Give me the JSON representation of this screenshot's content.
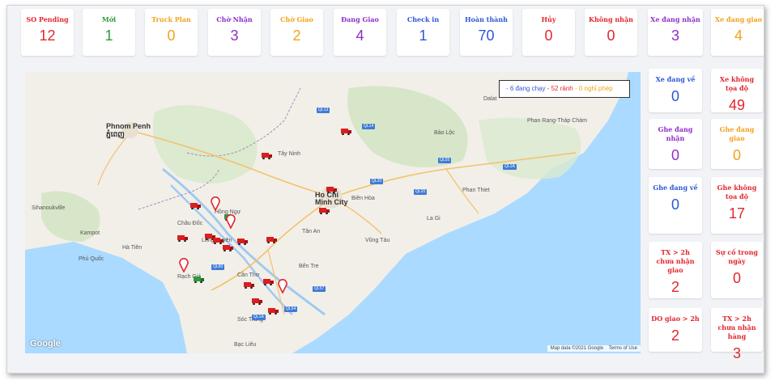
{
  "top_stats": [
    {
      "label": "SO Pending",
      "value": "12",
      "label_color": "#e3262d",
      "value_color": "#e3262d"
    },
    {
      "label": "Mới",
      "value": "1",
      "label_color": "#2c9a3a",
      "value_color": "#2c9a3a"
    },
    {
      "label": "Truck Plan",
      "value": "0",
      "label_color": "#f2a31a",
      "value_color": "#f2a31a"
    },
    {
      "label": "Chờ Nhận",
      "value": "3",
      "label_color": "#8e2fc9",
      "value_color": "#8e2fc9"
    },
    {
      "label": "Chờ Giao",
      "value": "2",
      "label_color": "#f2a31a",
      "value_color": "#f2a31a"
    },
    {
      "label": "Đang Giao",
      "value": "4",
      "label_color": "#8e2fc9",
      "value_color": "#8e2fc9"
    },
    {
      "label": "Check in",
      "value": "1",
      "label_color": "#2f56d6",
      "value_color": "#2f56d6"
    },
    {
      "label": "Hoàn thành",
      "value": "70",
      "label_color": "#2f56d6",
      "value_color": "#2f56d6"
    },
    {
      "label": "Hủy",
      "value": "0",
      "label_color": "#e3262d",
      "value_color": "#e3262d"
    },
    {
      "label": "Không nhận",
      "value": "0",
      "label_color": "#e3262d",
      "value_color": "#e3262d"
    },
    {
      "label": "Xe đang nhận",
      "value": "3",
      "label_color": "#8e2fc9",
      "value_color": "#8e2fc9"
    },
    {
      "label": "Xe đang giao",
      "value": "4",
      "label_color": "#f2a31a",
      "value_color": "#f2a31a"
    }
  ],
  "side_stats": [
    {
      "label": "Xe đang về",
      "value": "0",
      "label_color": "#2f56d6",
      "value_color": "#2f56d6"
    },
    {
      "label": "Xe không tọa độ",
      "value": "49",
      "label_color": "#e3262d",
      "value_color": "#e3262d"
    },
    {
      "label": "Ghe đang nhận",
      "value": "0",
      "label_color": "#8e2fc9",
      "value_color": "#8e2fc9"
    },
    {
      "label": "Ghe đang giao",
      "value": "0",
      "label_color": "#f2a31a",
      "value_color": "#f2a31a"
    },
    {
      "label": "Ghe đang về",
      "value": "0",
      "label_color": "#2f56d6",
      "value_color": "#2f56d6"
    },
    {
      "label": "Ghe không tọa độ",
      "value": "17",
      "label_color": "#e3262d",
      "value_color": "#e3262d"
    },
    {
      "label": "TX > 2h chưa nhận giao",
      "value": "2",
      "label_color": "#e3262d",
      "value_color": "#e3262d"
    },
    {
      "label": "Sự cố trong ngày",
      "value": "0",
      "label_color": "#e3262d",
      "value_color": "#e3262d"
    },
    {
      "label": "DO giao > 2h",
      "value": "2",
      "label_color": "#e3262d",
      "value_color": "#e3262d"
    },
    {
      "label": "TX > 2h chưa nhận hàng",
      "value": "3",
      "label_color": "#e3262d",
      "value_color": "#e3262d"
    }
  ],
  "map": {
    "legend_running": "- 6 đang chạy",
    "legend_idle": "- 52 rảnh",
    "legend_leave": "- 0 nghỉ phép",
    "google_logo": "Google",
    "attribution_data": "Map data ©2021 Google",
    "attribution_terms": "Terms of Use",
    "places": {
      "phnom_penh": "Phnom Penh",
      "phnom_penh_khmer": "ភ្នំពេញ",
      "ho_chi_minh": "Ho Chi Minh City",
      "tay_ninh": "Tây Ninh",
      "chau_doc": "Châu Đốc",
      "long_xuyen": "Long Xuyên",
      "can_tho": "Cần Thơ",
      "soc_trang": "Sóc Trăng",
      "bac_lieu": "Bạc Liêu",
      "ben_tre": "Bến Tre",
      "vung_tau": "Vũng Tàu",
      "phan_thiet": "Phan Thiet",
      "bao_loc": "Bảo Lộc",
      "phu_quoc": "Phú Quốc",
      "rach_gia": "Rạch Giá",
      "ha_tien": "Hà Tiên",
      "hong_ngu": "Hồng Ngự",
      "tan_an": "Tân An",
      "bien_hoa": "Biên Hòa",
      "la_gi": "La Gi",
      "phan_rang": "Phan Rang-Tháp Chàm",
      "sihanouk": "Sihanoukville",
      "kampot": "Kampot",
      "dalat": "Dalat"
    }
  }
}
